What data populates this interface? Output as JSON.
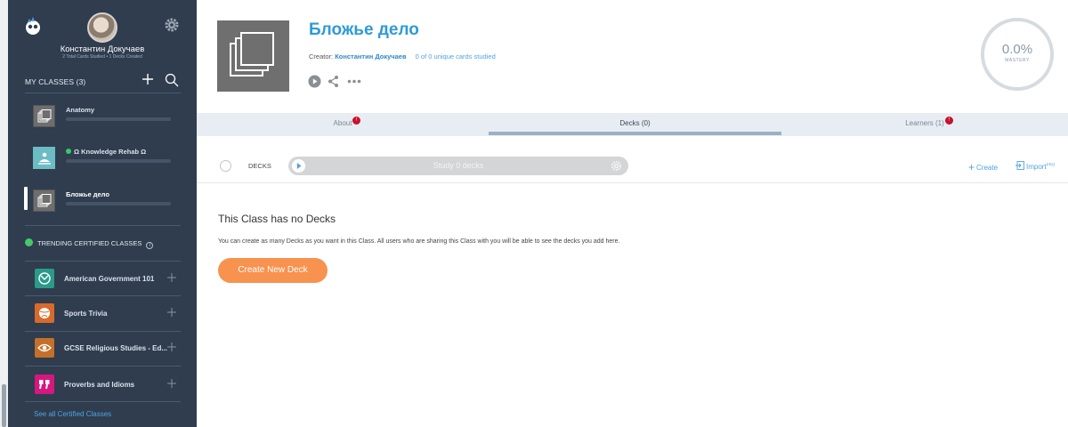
{
  "user": {
    "name": "Константин Докучаев",
    "stats": "2 Total Cards Studied • 1 Decks Created"
  },
  "sidebar": {
    "my_classes_label": "MY CLASSES (3)",
    "classes": [
      {
        "name": "Anatomy"
      },
      {
        "name": "Ω Knowledge Rehab Ω"
      },
      {
        "name": "Бложье дело"
      }
    ],
    "trending_label": "TRENDING CERTIFIED CLASSES",
    "certified": [
      {
        "name": "American Government 101",
        "color": "#2a9a8a"
      },
      {
        "name": "Sports Trivia",
        "color": "#d86a2b"
      },
      {
        "name": "GCSE Religious Studies - Ed...",
        "color": "#c4702a"
      },
      {
        "name": "Proverbs and Idioms",
        "color": "#d6177f"
      }
    ],
    "see_all": "See all Certified Classes"
  },
  "header": {
    "title": "Бложье дело",
    "creator_label": "Creator:",
    "creator_name": "Константин Докучаев",
    "unique_cards": "0 of 0 unique cards studied",
    "mastery_value": "0.0%",
    "mastery_label": "MASTERY"
  },
  "tabs": [
    {
      "label": "About",
      "badge": "!"
    },
    {
      "label": "Decks (0)"
    },
    {
      "label": "Learners (1)",
      "badge": "!"
    }
  ],
  "deck_bar": {
    "decks_label": "DECKS",
    "study_label": "Study 0 decks",
    "create_label": "Create",
    "import_label": "Import",
    "import_sup": "PRO"
  },
  "empty": {
    "title": "This Class has no Decks",
    "description": "You can create as many Decks as you want in this Class. All users who are sharing this Class with you will be able to see the decks you add here.",
    "button": "Create New Deck"
  },
  "colors": {
    "sidebar_bg": "#2f3d4f",
    "accent_blue": "#2e9ad8",
    "button_orange": "#f8924f",
    "badge_red": "#c8102e"
  }
}
